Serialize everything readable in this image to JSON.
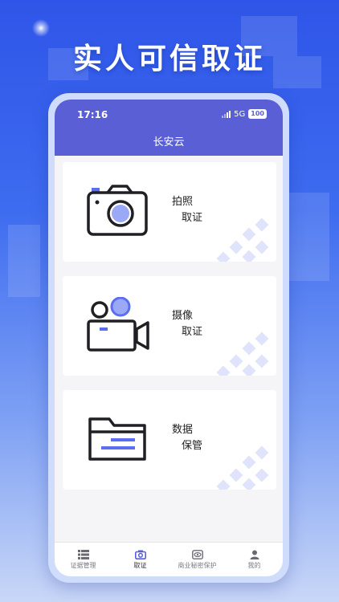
{
  "headline": "实人可信取证",
  "status": {
    "time": "17:16",
    "network": "5G",
    "battery": "100"
  },
  "app": {
    "title": "长安云"
  },
  "cards": [
    {
      "line1": "拍照",
      "line2": "取证",
      "icon": "camera-icon"
    },
    {
      "line1": "摄像",
      "line2": "取证",
      "icon": "video-camera-icon"
    },
    {
      "line1": "数据",
      "line2": "保管",
      "icon": "folder-icon"
    }
  ],
  "tabs": [
    {
      "label": "证据管理",
      "icon": "list-icon"
    },
    {
      "label": "取证",
      "icon": "camera-icon"
    },
    {
      "label": "商业秘密保护",
      "icon": "eye-icon"
    },
    {
      "label": "我的",
      "icon": "user-icon"
    }
  ],
  "colors": {
    "accent": "#5a5fd6",
    "background": "#3e6cf0",
    "icon_blue": "#5b6df0"
  }
}
